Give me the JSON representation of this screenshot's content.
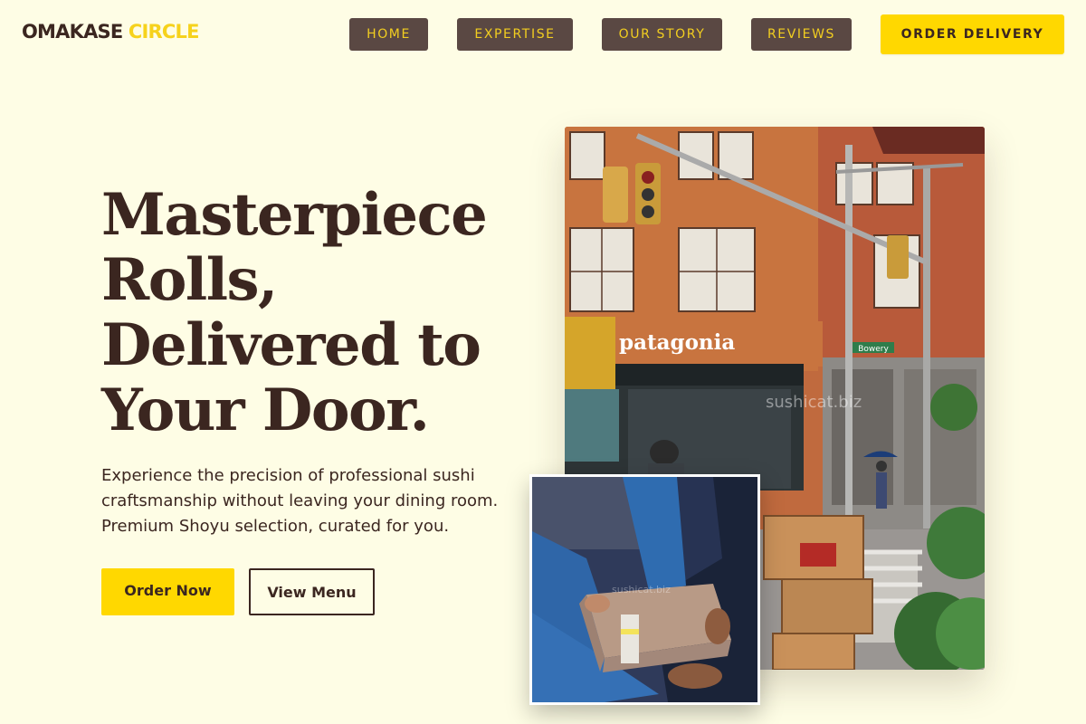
{
  "brand": {
    "name_part1": "OMAKASE",
    "name_part2": "CIRCLE",
    "accent_color": "#F6D21C"
  },
  "nav": {
    "items": [
      {
        "label": "HOME"
      },
      {
        "label": "EXPERTISE"
      },
      {
        "label": "OUR STORY"
      },
      {
        "label": "REVIEWS"
      }
    ],
    "cta_label": "ORDER DELIVERY"
  },
  "hero": {
    "title_lines": [
      "Masterpiece",
      "Rolls,",
      "Delivered to",
      "Your Door."
    ],
    "description_lines": [
      "Experience the precision of professional sushi",
      "craftsmanship without leaving your dining room.",
      "Premium Shoyu selection, curated for you."
    ],
    "primary_button": "Order Now",
    "secondary_button": "View Menu"
  },
  "images": {
    "street_photo": {
      "store_sign": "patagonia",
      "street_sign": "Bowery",
      "watermark": "sushicat.biz"
    },
    "delivery_photo": {
      "watermark": "sushicat.biz"
    }
  },
  "colors": {
    "background": "#FEFDE5",
    "text_dark": "#3b2620",
    "nav_button_bg": "#5a4843",
    "nav_button_text": "#F2CE20",
    "cta_yellow": "#FFD800"
  }
}
